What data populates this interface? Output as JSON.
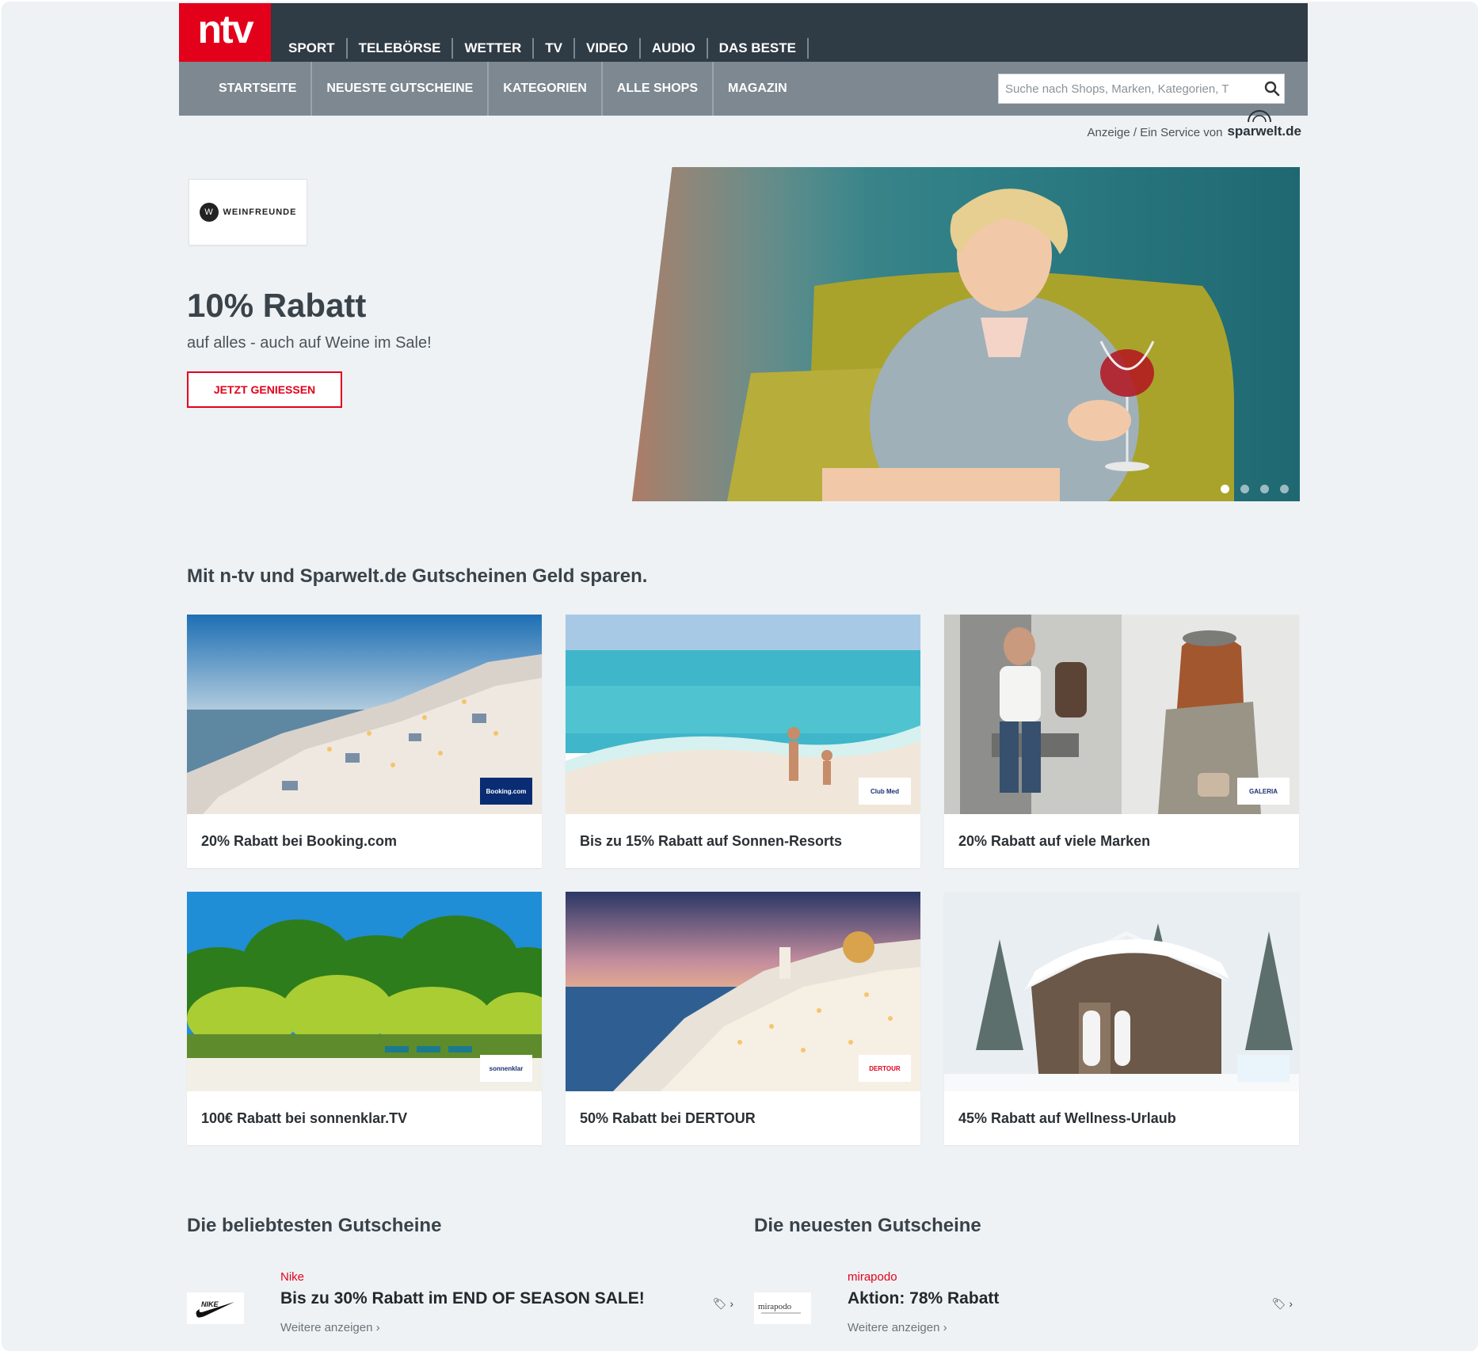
{
  "logo": {
    "text": "ntv"
  },
  "top_nav": [
    "SPORT",
    "TELEBÖRSE",
    "WETTER",
    "TV",
    "VIDEO",
    "AUDIO",
    "DAS BESTE"
  ],
  "sub_nav": [
    "STARTSEITE",
    "NEUESTE GUTSCHEINE",
    "KATEGORIEN",
    "ALLE SHOPS",
    "MAGAZIN"
  ],
  "search": {
    "placeholder": "Suche nach Shops, Marken, Kategorien, T"
  },
  "ad_note": {
    "text": "Anzeige / Ein Service von",
    "partner": "sparwelt.de"
  },
  "hero": {
    "brand": "WEINFREUNDE",
    "title": "10% Rabatt",
    "subtitle": "auf alles - auch auf Weine im Sale!",
    "button": "JETZT GENIESSEN",
    "slides_total": 4,
    "active_slide": 1
  },
  "deals_section": {
    "title": "Mit n-tv und Sparwelt.de Gutscheinen Geld sparen.",
    "cards": [
      {
        "label": "20% Rabatt bei Booking.com",
        "badge": "Booking.com"
      },
      {
        "label": "Bis zu 15% Rabatt auf Sonnen-Resorts",
        "badge": "Club Med"
      },
      {
        "label": "20% Rabatt auf viele Marken",
        "badge": "GALERIA"
      },
      {
        "label": "100€ Rabatt bei sonnenklar.TV",
        "badge": "sonnenklar"
      },
      {
        "label": "50% Rabatt bei DERTOUR",
        "badge": "DERTOUR"
      },
      {
        "label": "45% Rabatt auf Wellness-Urlaub",
        "badge": ""
      }
    ]
  },
  "popular": {
    "title": "Die beliebtesten Gutscheine",
    "item": {
      "shop": "Nike",
      "title": "Bis zu 30% Rabatt im END OF SEASON SALE!",
      "more": "Weitere anzeigen ›",
      "tag": "🏷 ›"
    }
  },
  "newest": {
    "title": "Die neuesten Gutscheine",
    "item": {
      "shop": "mirapodo",
      "title": "Aktion: 78% Rabatt",
      "more": "Weitere anzeigen ›",
      "tag": "🏷 ›"
    }
  }
}
